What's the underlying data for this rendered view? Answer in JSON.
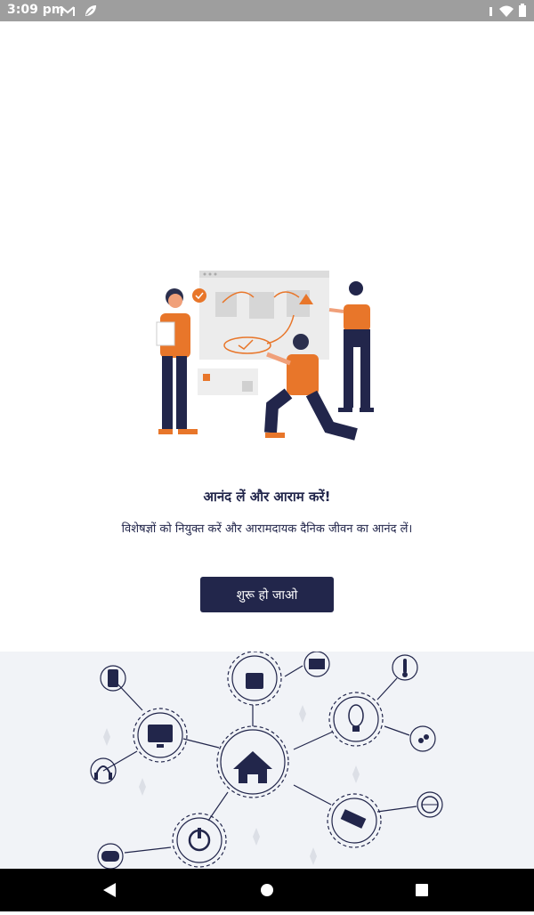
{
  "status_bar": {
    "time": "3:09 pm",
    "left_icons": [
      "gmail-icon",
      "leaf-icon"
    ],
    "right_icons": [
      "signal-icon",
      "wifi-icon",
      "battery-icon"
    ]
  },
  "onboarding": {
    "headline": "आनंद लें और आराम करें!",
    "subtext": "विशेषज्ञों को नियुक्त करें और आरामदायक दैनिक जीवन का आनंद लें।",
    "start_button_label": "शुरू हो जाओ"
  },
  "footer_icons": [
    "phone-icon",
    "lock-icon",
    "mail-icon",
    "thermometer-icon",
    "monitor-icon",
    "bulb-icon",
    "home-hub-icon",
    "water-drop-icon",
    "headphones-icon",
    "camera-icon",
    "globe-icon",
    "power-icon",
    "gamepad-icon"
  ],
  "navigation": [
    "back-button",
    "home-button",
    "recents-button"
  ],
  "colors": {
    "primary": "#22264b",
    "accent": "#e8762a",
    "footer_bg": "#f1f3f7",
    "status_bar": "#9e9e9e"
  }
}
